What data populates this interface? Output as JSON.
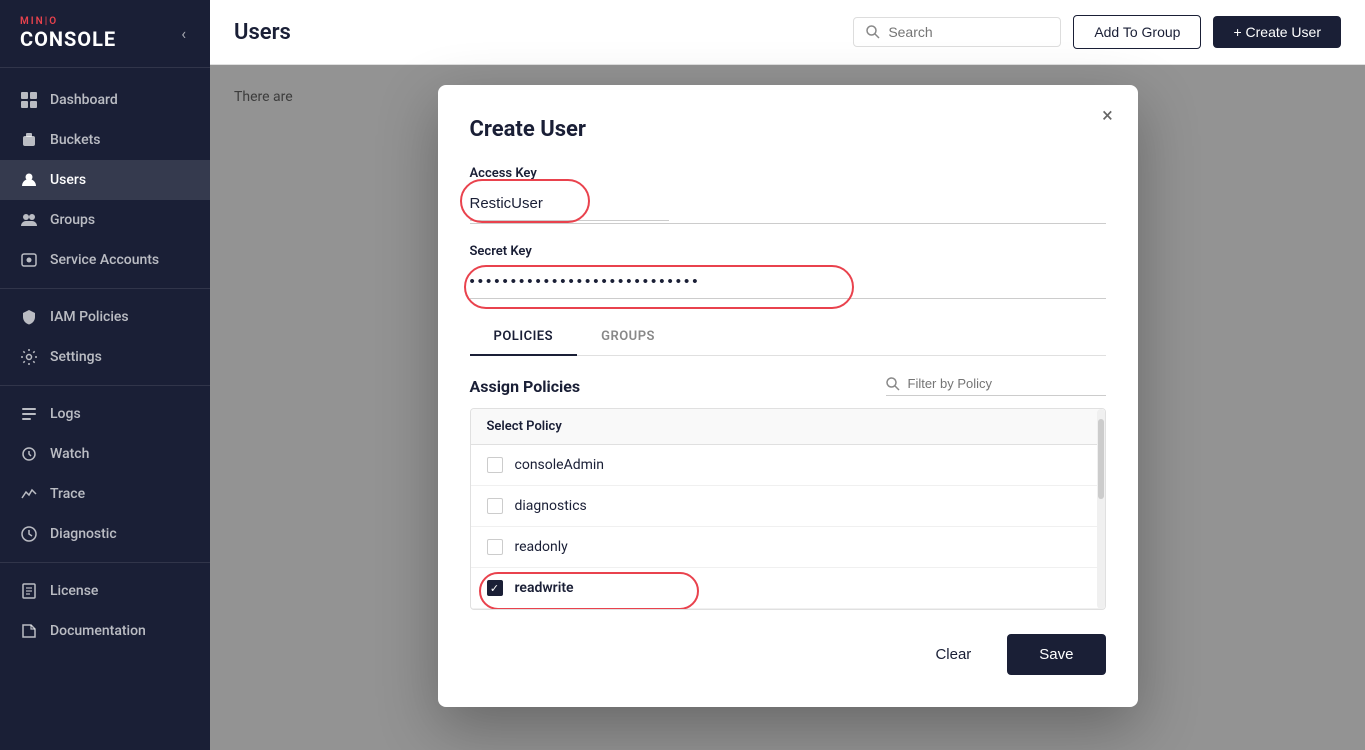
{
  "sidebar": {
    "logo": {
      "mini": "MIN|O",
      "console": "CONSOLE"
    },
    "items": [
      {
        "id": "dashboard",
        "label": "Dashboard",
        "icon": "grid"
      },
      {
        "id": "buckets",
        "label": "Buckets",
        "icon": "bucket"
      },
      {
        "id": "users",
        "label": "Users",
        "icon": "user",
        "active": true
      },
      {
        "id": "groups",
        "label": "Groups",
        "icon": "group"
      },
      {
        "id": "service-accounts",
        "label": "Service Accounts",
        "icon": "service"
      },
      {
        "id": "iam-policies",
        "label": "IAM Policies",
        "icon": "shield"
      },
      {
        "id": "settings",
        "label": "Settings",
        "icon": "gear"
      },
      {
        "id": "logs",
        "label": "Logs",
        "icon": "logs"
      },
      {
        "id": "watch",
        "label": "Watch",
        "icon": "watch"
      },
      {
        "id": "trace",
        "label": "Trace",
        "icon": "trace"
      },
      {
        "id": "diagnostic",
        "label": "Diagnostic",
        "icon": "diagnostic"
      },
      {
        "id": "license",
        "label": "License",
        "icon": "license"
      },
      {
        "id": "documentation",
        "label": "Documentation",
        "icon": "docs"
      }
    ]
  },
  "header": {
    "title": "Users",
    "search_placeholder": "Search",
    "add_to_group_label": "Add To Group",
    "create_user_label": "+ Create User"
  },
  "main": {
    "info_text": "There are"
  },
  "modal": {
    "title": "Create User",
    "close_label": "×",
    "access_key_label": "Access Key",
    "access_key_value": "ResticUser",
    "secret_key_label": "Secret Key",
    "secret_key_value": "••••••••••••••••••••••••••••••",
    "tabs": [
      {
        "id": "policies",
        "label": "POLICIES",
        "active": true
      },
      {
        "id": "groups",
        "label": "GROUPS",
        "active": false
      }
    ],
    "assign_policies_label": "Assign Policies",
    "filter_placeholder": "Filter by Policy",
    "select_policy_label": "Select Policy",
    "policies": [
      {
        "id": "consoleAdmin",
        "name": "consoleAdmin",
        "checked": false
      },
      {
        "id": "diagnostics",
        "name": "diagnostics",
        "checked": false
      },
      {
        "id": "readonly",
        "name": "readonly",
        "checked": false
      },
      {
        "id": "readwrite",
        "name": "readwrite",
        "checked": true
      }
    ],
    "clear_label": "Clear",
    "save_label": "Save"
  }
}
